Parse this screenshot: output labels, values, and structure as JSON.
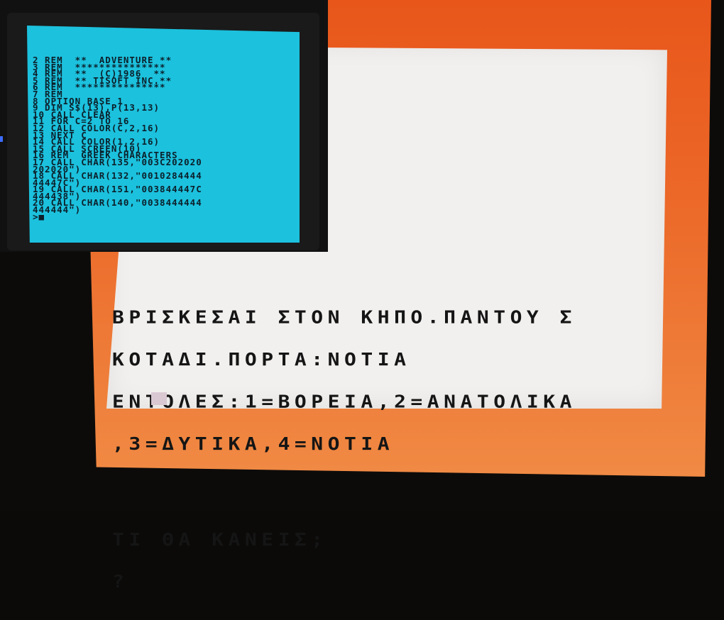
{
  "right_screen": {
    "lines": [
      "ΒΡΙΣΚΕΣΑΙ ΣΤΟΝ ΚΗΠΟ.ΠΑΝΤΟΥ Σ",
      "ΚΟΤΑΔΙ.ΠΟΡΤΑ:ΝΟΤΙΑ",
      "ΕΝΤΟΛΕΣ:1=ΒΟΡΕΙΑ,2=ΑΝΑΤΟΛΙΚΑ",
      ",3=ΔΥΤΙΚΑ,4=ΝΟΤΙΑ"
    ],
    "question": "ΤΙ ΘΑ ΚΑΝΕΙΣ;",
    "prompt": "?"
  },
  "left_screen": {
    "code_lines": [
      "2 REM  **  ADVENTURE **",
      "3 REM  ***************",
      "4 REM  **  (C)1986  **",
      "5 REM  ** TISOFT INC.**",
      "6 REM  ***************",
      "7 REM",
      "8 OPTION BASE 1",
      "9 DIM S$(13),P(13,13)",
      "10 CALL CLEAR",
      "11 FOR C=2 TO 16",
      "12 CALL COLOR(C,2,16)",
      "13 NEXT C",
      "14 CALL COLOR(1,2,16)",
      "15 CALL SCREEN(10)",
      "16 REM  GREEK CHARACTERS",
      "17 CALL CHAR(135,\"003C202020",
      "202020\")",
      "18 CALL CHAR(132,\"0010284444",
      "44447C\")",
      "19 CALL CHAR(151,\"003844447C",
      "444438\")",
      "20 CALL CHAR(140,\"0038444444",
      "444444\")"
    ],
    "prompt": ">",
    "cursor": "■"
  },
  "colors": {
    "orange_border": "#e8561a",
    "orange_screen": "#f2f0ee",
    "cyan_screen": "#1cc1dd",
    "text_dark": "#151515"
  }
}
